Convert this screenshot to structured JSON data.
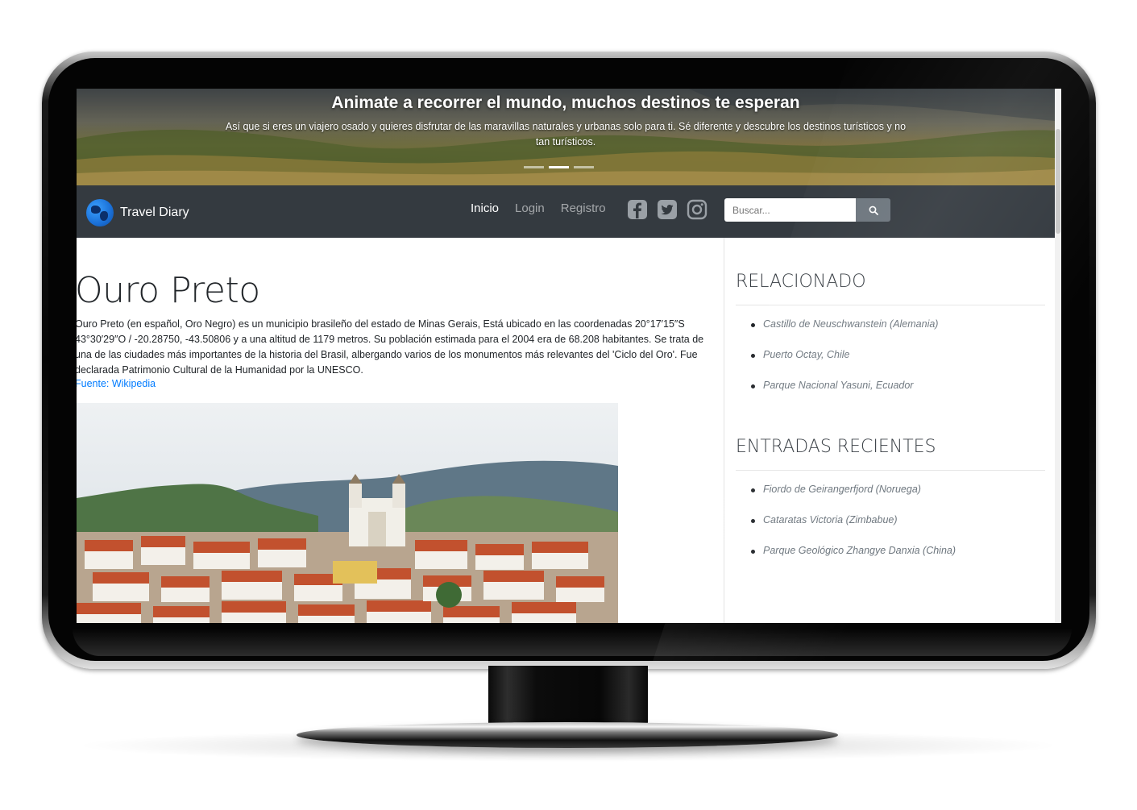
{
  "hero": {
    "title": "Animate a recorrer el mundo, muchos destinos te esperan",
    "subtitle": "Así que si eres un viajero osado y quieres disfrutar de las maravillas naturales y urbanas solo para ti. Sé diferente y descubre los destinos turísticos y no tan turísticos.",
    "slides": 3,
    "active_slide": 1
  },
  "navbar": {
    "brand": "Travel Diary",
    "links": [
      {
        "label": "Inicio",
        "active": true
      },
      {
        "label": "Login",
        "active": false
      },
      {
        "label": "Registro",
        "active": false
      }
    ],
    "social_icons": [
      "facebook-icon",
      "twitter-icon",
      "instagram-icon"
    ],
    "search": {
      "placeholder": "Buscar..."
    }
  },
  "article": {
    "title": "Ouro Preto",
    "body": "Ouro Preto (en español, Oro Negro) es un municipio brasileño del estado de Minas Gerais, Está ubicado en las coordenadas 20°17′15″S 43°30′29″O / -20.28750, -43.50806 y a una altitud de 1179 metros. Su población estimada para el 2004 era de 68.208 habitantes. Se trata de una de las ciudades más importantes de la historia del Brasil, albergando varios de los monumentos más relevantes del 'Ciclo del Oro'. Fue declarada Patrimonio Cultural de la Humanidad por la UNESCO.",
    "source": "Fuente: Wikipedia"
  },
  "sidebar": {
    "related": {
      "title": "RELACIONADO",
      "items": [
        "Castillo de Neuschwanstein (Alemania)",
        "Puerto Octay, Chile",
        "Parque Nacional Yasuni, Ecuador"
      ]
    },
    "recent": {
      "title": "ENTRADAS RECIENTES",
      "items": [
        "Fiordo de Geirangerfjord (Noruega)",
        "Cataratas Victoria (Zimbabue)",
        "Parque Geológico Zhangye Danxia (China)"
      ]
    }
  },
  "colors": {
    "navbar_bg": "#343a40",
    "link": "#007bff",
    "muted": "#6c757d",
    "brand_icon": "#1a6fd6"
  }
}
